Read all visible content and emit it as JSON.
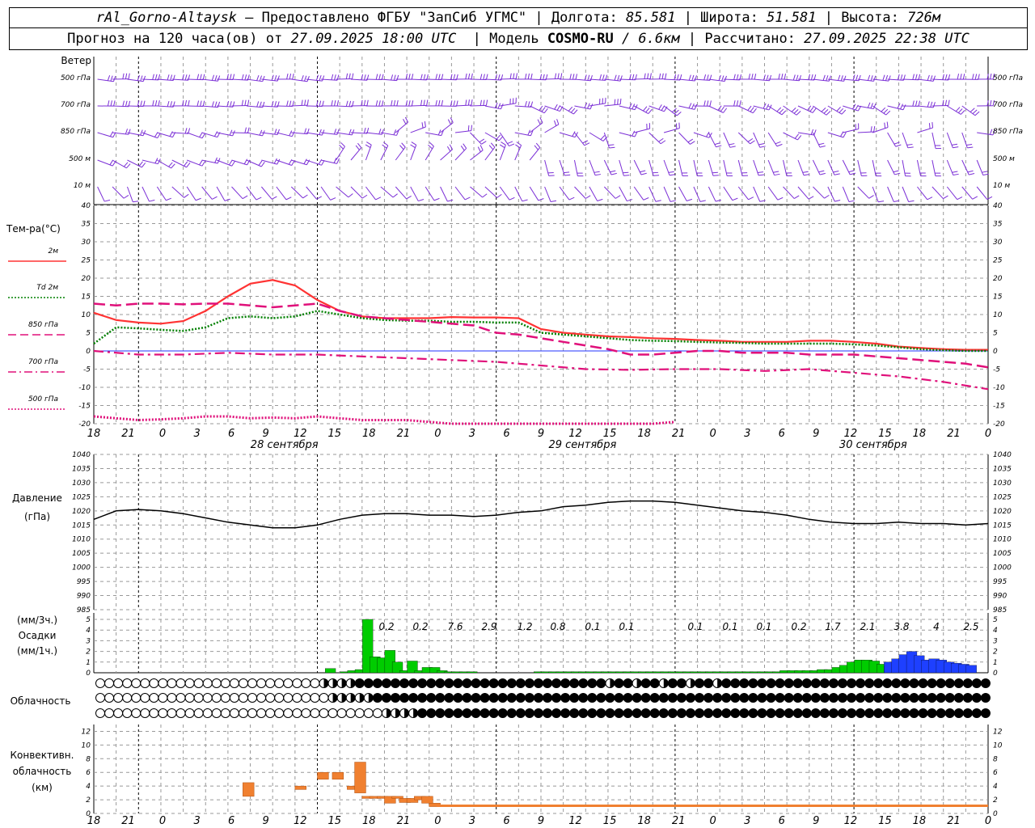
{
  "header": {
    "station": "rAl_Gorno-Altaysk",
    "provider": "– Предоставлено ФГБУ \"ЗапСиб УГМС\"",
    "lon_label": "Долгота:",
    "lon": "85.581",
    "lat_label": "Широта:",
    "lat": "51.581",
    "alt_label": "Высота:",
    "alt": "726м",
    "forecast_prefix": "Прогноз на 120 часа(ов) от",
    "forecast_time": "27.09.2025 18:00 UTC",
    "model_label": "Модель",
    "model": "COSMO-RU",
    "resolution": "/ 6.6км",
    "computed_label": "Рассчитано:",
    "computed_time": "27.09.2025 22:38 UTC"
  },
  "wind_panel": {
    "title": "Ветер",
    "levels": [
      "500 гПа",
      "700 гПа",
      "850 гПа",
      "500 м",
      "10  м"
    ]
  },
  "temp_panel": {
    "title": "Тем-ра(°С)",
    "legend": [
      {
        "label": "2м",
        "color": "#ff3333",
        "style": "solid"
      },
      {
        "label": "Td  2м",
        "color": "#008000",
        "style": "dotted"
      },
      {
        "label": "850 гПа",
        "color": "#e0107a",
        "style": "dashed"
      },
      {
        "label": "700 гПа",
        "color": "#e0107a",
        "style": "dashdot"
      },
      {
        "label": "500 гПа",
        "color": "#e0107a",
        "style": "dotted"
      }
    ],
    "yticks": [
      40,
      35,
      30,
      25,
      20,
      15,
      10,
      5,
      0,
      -5,
      -10,
      -15,
      -20
    ]
  },
  "x_axis": {
    "hour_labels": [
      "18",
      "21",
      "0",
      "3",
      "6",
      "9",
      "12",
      "15",
      "18",
      "21",
      "0",
      "3",
      "6",
      "9",
      "12",
      "15",
      "18",
      "21",
      "0",
      "3",
      "6",
      "9",
      "12",
      "15",
      "18",
      "21",
      "0"
    ],
    "date_labels": [
      "28 сентября",
      "29 сентября",
      "30 сентября"
    ]
  },
  "pressure_panel": {
    "title": "Давление",
    "unit": "(гПа)",
    "yticks": [
      1040,
      1035,
      1030,
      1025,
      1020,
      1015,
      1010,
      1005,
      1000,
      995,
      990,
      985
    ]
  },
  "precip_panel": {
    "unit3": "(мм/3ч.)",
    "title": "Осадки",
    "unit1": "(мм/1ч.)",
    "yticks": [
      5,
      4,
      3,
      2,
      1,
      0
    ],
    "totals": [
      {
        "value": "0.2",
        "hour": 6
      },
      {
        "value": "0.2",
        "hour": 9
      },
      {
        "value": "7.6",
        "hour": 12
      },
      {
        "value": "2.9",
        "hour": 15
      },
      {
        "value": "1.2",
        "hour": 18
      },
      {
        "value": "0.8",
        "hour": 21
      },
      {
        "value": "0.1",
        "hour": 24
      },
      {
        "value": "0.1",
        "hour": 27
      },
      {
        "value": "0.1",
        "hour": 33
      },
      {
        "value": "0.1",
        "hour": 36
      },
      {
        "value": "0.1",
        "hour": 39
      },
      {
        "value": "0.2",
        "hour": 42
      },
      {
        "value": "1.7",
        "hour": 45
      },
      {
        "value": "2.1",
        "hour": 48
      },
      {
        "value": "3.8",
        "hour": 51
      },
      {
        "value": "4",
        "hour": 54
      },
      {
        "value": "2.5",
        "hour": 57
      }
    ]
  },
  "cloud_panel": {
    "title": "Облачность"
  },
  "conv_panel": {
    "title1": "Конвективн.",
    "title2": "облачность",
    "unit": "(км)",
    "yticks": [
      12,
      10,
      8,
      6,
      4,
      2,
      0
    ]
  },
  "chart_data": [
    {
      "type": "line",
      "title": "Тем-ра(°С)",
      "x_unit": "hours from 27.09.2025 18:00 UTC",
      "ylim": [
        -20,
        40
      ],
      "series": [
        {
          "name": "2м",
          "x": [
            0,
            3,
            6,
            9,
            12,
            15,
            18,
            21,
            24,
            27,
            30,
            33,
            36,
            39,
            42,
            45,
            48,
            51,
            54,
            57,
            60,
            63,
            66,
            69,
            72,
            75,
            78,
            81,
            84,
            87,
            90,
            93,
            96,
            99,
            102,
            105,
            108,
            111,
            114,
            117,
            120
          ],
          "values": [
            10.5,
            8.5,
            7.8,
            7.5,
            8.2,
            11,
            15,
            18.5,
            19.5,
            18,
            14,
            11,
            9.5,
            9,
            9,
            9,
            9.3,
            9.2,
            9.2,
            9,
            6,
            5,
            4.5,
            4,
            3.8,
            3.5,
            3.3,
            3,
            2.8,
            2.5,
            2.5,
            2.5,
            2.8,
            2.8,
            2.5,
            2,
            1.2,
            0.8,
            0.5,
            0.3,
            0.3
          ]
        },
        {
          "name": "Td  2м",
          "x": [
            0,
            3,
            6,
            9,
            12,
            15,
            18,
            21,
            24,
            27,
            30,
            33,
            36,
            39,
            42,
            45,
            48,
            51,
            54,
            57,
            60,
            63,
            66,
            69,
            72,
            75,
            78,
            81,
            84,
            87,
            90,
            93,
            96,
            99,
            102,
            105,
            108,
            111,
            114,
            117,
            120
          ],
          "values": [
            2,
            6.5,
            6.2,
            5.8,
            5.5,
            6.5,
            9,
            9.5,
            9,
            9.5,
            11,
            10,
            9,
            8.5,
            8.3,
            8.3,
            8,
            8,
            7.8,
            7.8,
            5,
            4.5,
            4,
            3.5,
            3,
            2.8,
            2.7,
            2.5,
            2.3,
            2.2,
            2,
            2,
            2,
            2,
            1.8,
            1.5,
            1,
            0.5,
            0.2,
            0,
            0
          ]
        },
        {
          "name": "850 гПа",
          "x": [
            0,
            3,
            6,
            9,
            12,
            15,
            18,
            21,
            24,
            27,
            30,
            33,
            36,
            39,
            42,
            45,
            48,
            51,
            54,
            57,
            60,
            63,
            66,
            69,
            72,
            75,
            78,
            81,
            84,
            87,
            90,
            93,
            96,
            99,
            102,
            105,
            108,
            111,
            114,
            117,
            120
          ],
          "values": [
            13,
            12.5,
            13,
            13,
            12.8,
            13,
            13,
            12.5,
            12,
            12.5,
            13,
            11,
            9.5,
            9,
            8.5,
            8,
            7.5,
            7,
            5,
            4.5,
            3.5,
            2.5,
            1.5,
            0.5,
            -1,
            -1,
            -0.5,
            0,
            0,
            -0.5,
            -0.5,
            -0.5,
            -1,
            -1,
            -1,
            -1.5,
            -2,
            -2.5,
            -3,
            -3.5,
            -4.5
          ]
        },
        {
          "name": "700 гПа",
          "x": [
            0,
            6,
            12,
            18,
            24,
            30,
            36,
            42,
            48,
            54,
            60,
            66,
            72,
            78,
            84,
            90,
            96,
            102,
            108,
            114,
            120
          ],
          "values": [
            0,
            -1,
            -1,
            -0.5,
            -1,
            -1,
            -1.5,
            -2,
            -2.5,
            -3,
            -4,
            -5,
            -5.2,
            -5,
            -5,
            -5.5,
            -5,
            -6,
            -7,
            -8.5,
            -10.5
          ]
        },
        {
          "name": "500 гПа",
          "x": [
            0,
            3,
            6,
            9,
            12,
            15,
            18,
            21,
            24,
            27,
            30,
            33,
            36,
            39,
            42,
            45,
            48,
            51,
            54,
            57,
            60,
            63,
            66,
            69,
            72,
            75,
            78
          ],
          "values": [
            -18,
            -18.5,
            -19,
            -18.8,
            -18.5,
            -18,
            -18,
            -18.5,
            -18.3,
            -18.5,
            -18,
            -18.5,
            -19,
            -19,
            -19,
            -19.5,
            -20,
            -20,
            -20,
            -20,
            -20,
            -20,
            -20,
            -20,
            -20,
            -20,
            -19.5
          ]
        }
      ]
    },
    {
      "type": "line",
      "title": "Давление",
      "x_unit": "hours from 27.09.2025 18:00 UTC",
      "ylim": [
        985,
        1040
      ],
      "series": [
        {
          "name": "",
          "x": [
            0,
            3,
            6,
            9,
            12,
            15,
            18,
            21,
            24,
            27,
            30,
            33,
            36,
            39,
            42,
            45,
            48,
            51,
            54,
            57,
            60,
            63,
            66,
            69,
            72,
            75,
            78,
            81,
            84,
            87,
            90,
            93,
            96,
            99,
            102,
            105,
            108,
            111,
            114,
            117,
            120
          ],
          "values": [
            1017,
            1020,
            1020.5,
            1020,
            1019,
            1017.5,
            1016,
            1015,
            1014,
            1014,
            1015,
            1017,
            1018.5,
            1019,
            1019,
            1018.5,
            1018.5,
            1018,
            1018.5,
            1019.5,
            1020,
            1021.5,
            1022,
            1023,
            1023.5,
            1023.5,
            1023,
            1022,
            1021,
            1020,
            1019.5,
            1018.5,
            1017,
            1016,
            1015.5,
            1015.5,
            1016,
            1015.5,
            1015.5,
            1015,
            1015.5
          ]
        }
      ]
    },
    {
      "type": "bar",
      "title": "Осадки",
      "x_unit": "hours from 27.09.2025 18:00 UTC",
      "ylim": [
        0,
        5
      ],
      "series": [
        {
          "name": "rain",
          "color": "#00cc00",
          "x": [
            33,
            34,
            35,
            36,
            37,
            38,
            39,
            40,
            41,
            42,
            43,
            44,
            45,
            46,
            47,
            48,
            49,
            50,
            51,
            52,
            53,
            54,
            55,
            56,
            57,
            58,
            59,
            60,
            61,
            62,
            63,
            64,
            65,
            66,
            67,
            68,
            69,
            70,
            71,
            72,
            73,
            74,
            75,
            76,
            77,
            78,
            79,
            80,
            81,
            82,
            83,
            84,
            85,
            86,
            87,
            88,
            89,
            90,
            91,
            92,
            93,
            94,
            95,
            96,
            97,
            98,
            99,
            100,
            101,
            102,
            103,
            104,
            105,
            106,
            107,
            108,
            109
          ],
          "values": [
            0.4,
            0,
            0.1,
            0.2,
            0.3,
            5,
            1.5,
            1.4,
            2.1,
            1,
            0.2,
            1.1,
            0.2,
            0.5,
            0.5,
            0.2,
            0.1,
            0.1,
            0.1,
            0.1,
            0,
            0,
            0,
            0,
            0,
            0,
            0,
            0,
            0.1,
            0.1,
            0.1,
            0.1,
            0.1,
            0.1,
            0.1,
            0.1,
            0.1,
            0.1,
            0.1,
            0.1,
            0.1,
            0.1,
            0.1,
            0.1,
            0.1,
            0.1,
            0.1,
            0.1,
            0.1,
            0.1,
            0.1,
            0.1,
            0.1,
            0.1,
            0.1,
            0.1,
            0.1,
            0.1,
            0.1,
            0.1,
            0.1,
            0.2,
            0.2,
            0.2,
            0.2,
            0.2,
            0.3,
            0.3,
            0.5,
            0.7,
            1,
            1.2,
            1.2,
            1.1,
            0.8,
            0.6,
            0.6
          ]
        },
        {
          "name": "snow",
          "color": "#1e40ff",
          "x": [
            108,
            109,
            110,
            111,
            112,
            113,
            114,
            115,
            116,
            117,
            118,
            119
          ],
          "values": [
            1,
            1.3,
            1.7,
            2,
            1.6,
            1.2,
            1.3,
            1.2,
            1,
            0.9,
            0.8,
            0.7
          ]
        }
      ]
    },
    {
      "type": "bar",
      "title": "Конвективн. облачность",
      "x_unit": "hours from 27.09.2025 18:00 UTC",
      "ylim": [
        0,
        13
      ],
      "series": [
        {
          "name": "",
          "color": "#f08030",
          "x_bars": [
            [
              20,
              21,
              2.5,
              4.5
            ],
            [
              27,
              28,
              3.5,
              4
            ],
            [
              30,
              31,
              5,
              6
            ],
            [
              32,
              33,
              5,
              6
            ],
            [
              34,
              35,
              3.5,
              4
            ],
            [
              35,
              36,
              3,
              7.5
            ],
            [
              36,
              37,
              2.2,
              2.5
            ],
            [
              37,
              38,
              2.2,
              2.5
            ],
            [
              38,
              39,
              2.2,
              2.5
            ],
            [
              39,
              40,
              1.5,
              2.5
            ],
            [
              40,
              41,
              2.2,
              2.5
            ],
            [
              41,
              42,
              1.6,
              2.2
            ],
            [
              42,
              43,
              1.6,
              2.2
            ],
            [
              43,
              44,
              2,
              2.5
            ],
            [
              44,
              45,
              1.5,
              2.5
            ],
            [
              45,
              46,
              1,
              1.5
            ]
          ],
          "flat_top": 1.3
        }
      ]
    }
  ]
}
